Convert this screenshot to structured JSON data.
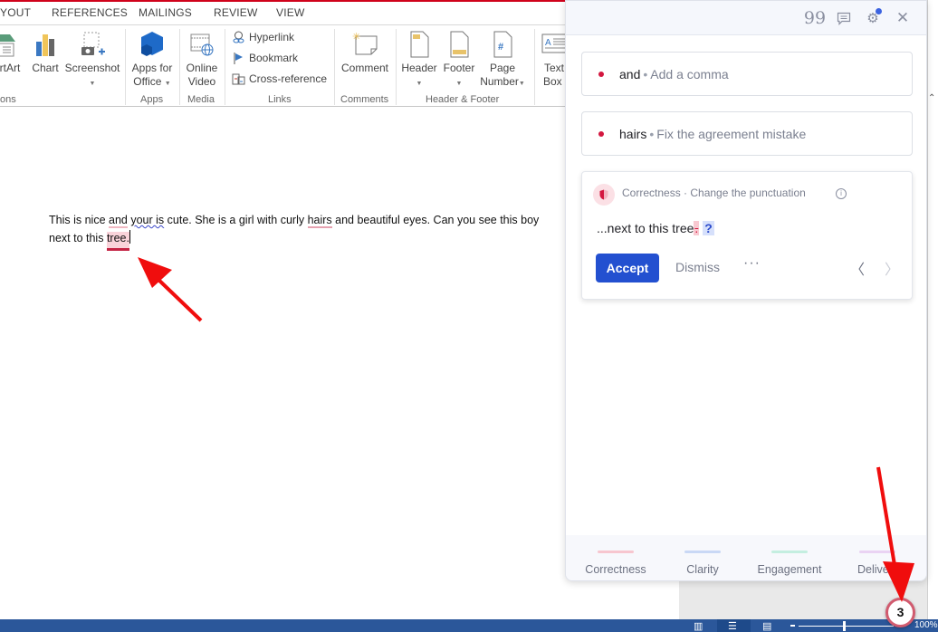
{
  "ribbon": {
    "tabs": [
      "YOUT",
      "REFERENCES",
      "MAILINGS",
      "REVIEW",
      "VIEW"
    ],
    "buttons": {
      "smartart": "rtArt",
      "chart": "Chart",
      "screenshot": "Screenshot",
      "apps_for_office_1": "Apps for",
      "apps_for_office_2": "Office",
      "online_video_1": "Online",
      "online_video_2": "Video",
      "hyperlink": "Hyperlink",
      "bookmark": "Bookmark",
      "cross_reference": "Cross-reference",
      "comment": "Comment",
      "header": "Header",
      "footer": "Footer",
      "page_number_1": "Page",
      "page_number_2": "Number",
      "text_box_1": "Text",
      "text_box_2": "Box"
    },
    "groups": {
      "illustrations": "ons",
      "apps": "Apps",
      "media": "Media",
      "links": "Links",
      "comments": "Comments",
      "header_footer": "Header & Footer"
    }
  },
  "document": {
    "line1": {
      "p1": "This is nice ",
      "and": "and",
      "sp1": " ",
      "your_is": "your is",
      "p2": " cute. She is a girl with curly ",
      "hairs": "hairs",
      "p3": " and beautiful eyes. Can you see this boy"
    },
    "line2": {
      "p1": "next to this ",
      "tree": "tree."
    }
  },
  "grammarly": {
    "header_icons": [
      "quote-icon",
      "feedback-icon",
      "settings-icon",
      "close-icon"
    ],
    "suggestions": [
      {
        "word": "and",
        "desc": "Add a comma"
      },
      {
        "word": "hairs",
        "desc": "Fix the agreement mistake"
      }
    ],
    "active": {
      "category": "Correctness · Change the punctuation",
      "preview_prefix": "...next to this tree",
      "removed": ".",
      "inserted": "?",
      "accept": "Accept",
      "dismiss": "Dismiss",
      "more": "···"
    },
    "footer_tabs": [
      {
        "label": "Correctness",
        "color": "#f7c6cf"
      },
      {
        "label": "Clarity",
        "color": "#c9d8f5"
      },
      {
        "label": "Engagement",
        "color": "#c4eee0"
      },
      {
        "label": "Delivery",
        "color": "#ead3f3"
      }
    ],
    "footer_tab_visible_4": "Delive",
    "issue_count": "3"
  },
  "status_bar": {
    "zoom": "100%"
  }
}
